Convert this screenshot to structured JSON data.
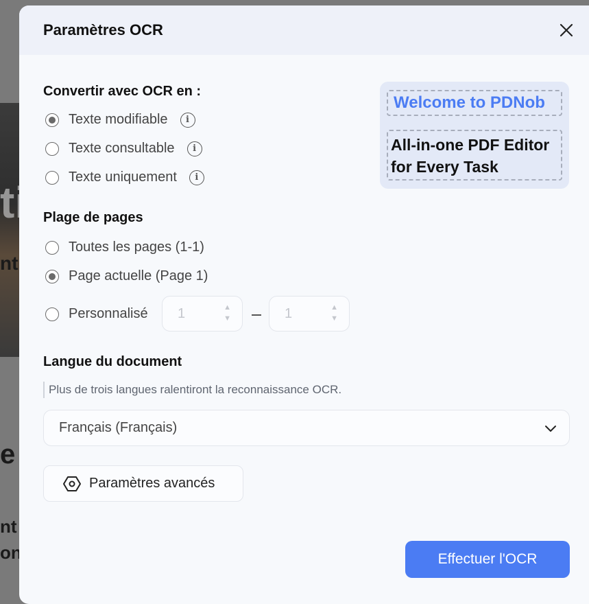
{
  "dialog": {
    "title": "Paramètres OCR"
  },
  "ocr_mode": {
    "heading": "Convertir avec OCR en :",
    "options": [
      {
        "label": "Texte modifiable",
        "checked": true
      },
      {
        "label": "Texte consultable",
        "checked": false
      },
      {
        "label": "Texte uniquement",
        "checked": false
      }
    ]
  },
  "promo": {
    "line1": "Welcome to PDNob",
    "line2a": "All-in-one PDF Editor",
    "line2b": "for Every Task"
  },
  "page_range": {
    "heading": "Plage de pages",
    "options": [
      {
        "label": "Toutes les pages (1-1)",
        "checked": false
      },
      {
        "label": "Page actuelle (Page 1)",
        "checked": true
      },
      {
        "label": "Personnalisé",
        "checked": false
      }
    ],
    "from_value": "1",
    "to_value": "1"
  },
  "language": {
    "heading": "Langue du document",
    "hint": "Plus de trois langues ralentiront la reconnaissance OCR.",
    "selected": "Français (Français)"
  },
  "buttons": {
    "advanced": "Paramètres avancés",
    "run": "Effectuer l'OCR"
  },
  "background_text": {
    "a": "ti",
    "b": "nt",
    "c": "e",
    "d": "nt",
    "e": "on"
  },
  "colors": {
    "accent": "#4b7cf3",
    "header_bg": "#eef1f9",
    "dialog_bg": "#f7f9fc"
  }
}
